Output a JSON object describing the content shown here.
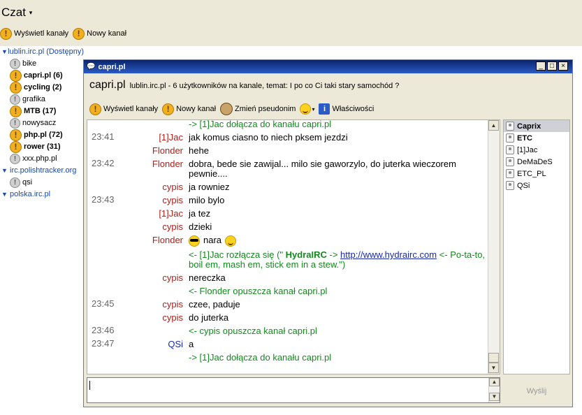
{
  "app": {
    "menu_title": "Czat",
    "menu_arrow": "▾"
  },
  "top_toolbar": {
    "show_channels": "Wyświetl kanały",
    "new_channel": "Nowy kanał"
  },
  "tree": [
    {
      "type": "server",
      "label": "lublin.irc.pl (Dostępny)"
    },
    {
      "type": "channel",
      "label": "bike",
      "bold": false
    },
    {
      "type": "channel",
      "label": "capri.pl (6)",
      "bold": true
    },
    {
      "type": "channel",
      "label": "cycling (2)",
      "bold": true
    },
    {
      "type": "channel",
      "label": "grafika",
      "bold": false
    },
    {
      "type": "channel",
      "label": "MTB (17)",
      "bold": true
    },
    {
      "type": "channel",
      "label": "nowysacz",
      "bold": false
    },
    {
      "type": "channel",
      "label": "php.pl (72)",
      "bold": true
    },
    {
      "type": "channel",
      "label": "rower (31)",
      "bold": true
    },
    {
      "type": "channel",
      "label": "xxx.php.pl",
      "bold": false
    },
    {
      "type": "server",
      "label": "irc.polishtracker.org"
    },
    {
      "type": "channel",
      "label": "qsi",
      "bold": false
    },
    {
      "type": "server",
      "label": "polska.irc.pl"
    }
  ],
  "window": {
    "title": "capri.pl",
    "min": "_",
    "max": "□",
    "close": "×",
    "channel_name": "capri.pl",
    "topic": "lublin.irc.pl - 6 użytkowników na kanale, temat: I po co Ci taki stary samochód ?",
    "toolbar": {
      "show_channels": "Wyświetl kanały",
      "new_channel": "Nowy kanał",
      "change_nick": "Zmień pseudonim",
      "properties": "Właściwości"
    },
    "send": "Wyślij"
  },
  "messages": [
    {
      "time": "",
      "nick": "",
      "text": "-> [1]Jac dołącza do kanału capri.pl",
      "kind": "sys"
    },
    {
      "time": "23:41",
      "nick": "[1]Jac",
      "text": "jak komus ciasno to niech pksem jezdzi",
      "kind": "msg"
    },
    {
      "time": "",
      "nick": "Flonder",
      "text": "hehe",
      "kind": "msg"
    },
    {
      "time": "23:42",
      "nick": "Flonder",
      "text": "dobra, bede sie zawijal... milo sie gaworzylo, do juterka wieczorem pewnie....",
      "kind": "msg"
    },
    {
      "time": "",
      "nick": "cypis",
      "text": "ja rowniez",
      "kind": "msg"
    },
    {
      "time": "23:43",
      "nick": "cypis",
      "text": "milo bylo",
      "kind": "msg"
    },
    {
      "time": "",
      "nick": "[1]Jac",
      "text": "ja tez",
      "kind": "msg"
    },
    {
      "time": "",
      "nick": "cypis",
      "text": "dzieki",
      "kind": "msg"
    },
    {
      "time": "",
      "nick": "Flonder",
      "text": "nara",
      "kind": "emoji"
    },
    {
      "time": "",
      "nick": "",
      "kind": "quit",
      "pre": "<- [1]Jac rozłącza się (\" ",
      "client": "HydraIRC",
      "mid": " -> ",
      "link": "http://www.hydrairc.com",
      "post": " <- Po-ta-to, boil em, mash em, stick em in a stew.\")"
    },
    {
      "time": "",
      "nick": "cypis",
      "text": "nereczka",
      "kind": "msg"
    },
    {
      "time": "",
      "nick": "",
      "text": "<- Flonder opuszcza kanał capri.pl",
      "kind": "sys"
    },
    {
      "time": "23:45",
      "nick": "cypis",
      "text": "czee, paduje",
      "kind": "msg"
    },
    {
      "time": "",
      "nick": "cypis",
      "text": "do juterka",
      "kind": "msg"
    },
    {
      "time": "23:46",
      "nick": "",
      "text": "<- cypis opuszcza kanał capri.pl",
      "kind": "sys"
    },
    {
      "time": "23:47",
      "nick": "QSi",
      "text": "a",
      "kind": "msg",
      "nick_color": "blue"
    },
    {
      "time": "",
      "nick": "",
      "text": "-> [1]Jac dołącza do kanału capri.pl",
      "kind": "sys"
    }
  ],
  "users": [
    {
      "name": "Caprix",
      "bold": true,
      "selected": true
    },
    {
      "name": "ETC",
      "bold": true,
      "selected": false
    },
    {
      "name": "[1]Jac",
      "bold": false,
      "selected": false
    },
    {
      "name": "DeMaDeS",
      "bold": false,
      "selected": false
    },
    {
      "name": "ETC_PL",
      "bold": false,
      "selected": false
    },
    {
      "name": "QSi",
      "bold": false,
      "selected": false
    }
  ],
  "colors": {
    "nick": "#b0201a",
    "system": "#14891d",
    "link": "#1a2aa8",
    "titlebar": "#0a246a"
  }
}
